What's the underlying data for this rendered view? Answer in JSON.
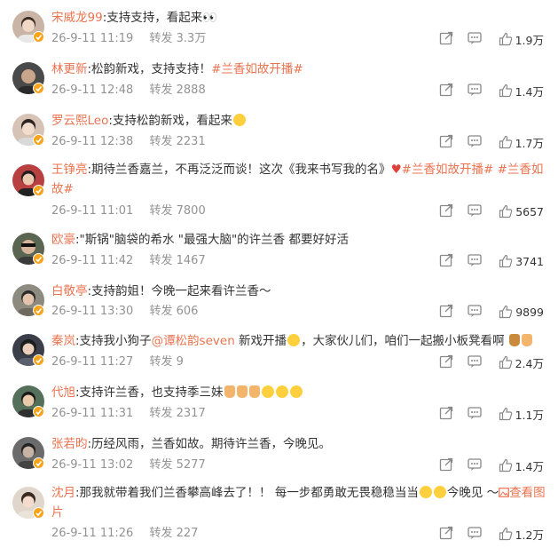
{
  "comments": [
    {
      "name": "宋威龙99",
      "body": ":支持支持，看起来",
      "emoji_after": "eyes",
      "tags": [],
      "date": "26-9-11 11:19",
      "repost_label": "转发",
      "repost_count": "3.3万",
      "likes": "1.9万",
      "avatar_color": "#c9b4a6"
    },
    {
      "name": "林更新",
      "body": ":松韵新戏，支持支持！",
      "tags": [
        "#兰香如故开播#"
      ],
      "date": "26-9-11 12:48",
      "repost_label": "转发",
      "repost_count": "2888",
      "likes": "1.4万",
      "avatar_color": "#4a4a4a"
    },
    {
      "name": "罗云熙Leo",
      "body": ":支持松韵新戏，看起来",
      "emoji_after": "grin",
      "tags": [],
      "date": "26-9-11 12:38",
      "repost_label": "转发",
      "repost_count": "2231",
      "likes": "1.7万",
      "avatar_color": "#d7c3b6"
    },
    {
      "name": "王铮亮",
      "body": ":期待兰香嘉兰，不再泛泛而谈！这次《我来书写我的名》",
      "heart": "♥",
      "tags": [
        "#兰香如故开播#",
        "#兰香如故#"
      ],
      "date": "26-9-11 11:01",
      "repost_label": "转发",
      "repost_count": "7800",
      "likes": "5657",
      "avatar_color": "#b94040"
    },
    {
      "name": "欧豪",
      "body": ":\"斯锅\"脑袋的希水 \"最强大脑\"的许兰香 都要好好活",
      "tags": [],
      "date": "26-9-11 11:42",
      "repost_label": "转发",
      "repost_count": "1467",
      "likes": "3741",
      "avatar_color": "#5b6652"
    },
    {
      "name": "白敬亭",
      "body": ":支持韵姐！今晚一起来看许兰香～",
      "tags": [],
      "date": "26-9-11 13:30",
      "repost_label": "转发",
      "repost_count": "606",
      "likes": "9899",
      "avatar_color": "#8d8a80"
    },
    {
      "name": "秦岚",
      "body_prefix": ":支持我小狗子",
      "mention": "@谭松韵seven",
      "body": " 新戏开播",
      "body_suffix": "，大家伙儿们，咱们一起搬小板凳看啊",
      "tags": [],
      "date": "26-9-11 11:27",
      "repost_label": "转发",
      "repost_count": "9",
      "likes": "2.4万",
      "avatar_color": "#3b3f4a"
    },
    {
      "name": "代旭",
      "body": ":支持许兰香，也支持季三妹",
      "tags": [],
      "date": "26-9-11 11:31",
      "repost_label": "转发",
      "repost_count": "2317",
      "likes": "1.1万",
      "avatar_color": "#55705a"
    },
    {
      "name": "张若昀",
      "body": ":历经风雨，兰香如故。期待许兰香，今晚见。",
      "tags": [],
      "date": "26-9-11 13:02",
      "repost_label": "转发",
      "repost_count": "5277",
      "likes": "1.4万",
      "avatar_color": "#6b6b6b"
    },
    {
      "name": "沈月",
      "body": ":那我就带着我们兰香攀高峰去了！！ 每一步都勇敢无畏稳稳当当",
      "body_suffix": "今晚见 ～",
      "see_pic": "查看图片",
      "tags": [],
      "date": "26-9-11 11:26",
      "repost_label": "转发",
      "repost_count": "227",
      "likes": "1.2万",
      "avatar_color": "#e0d6cc"
    }
  ]
}
